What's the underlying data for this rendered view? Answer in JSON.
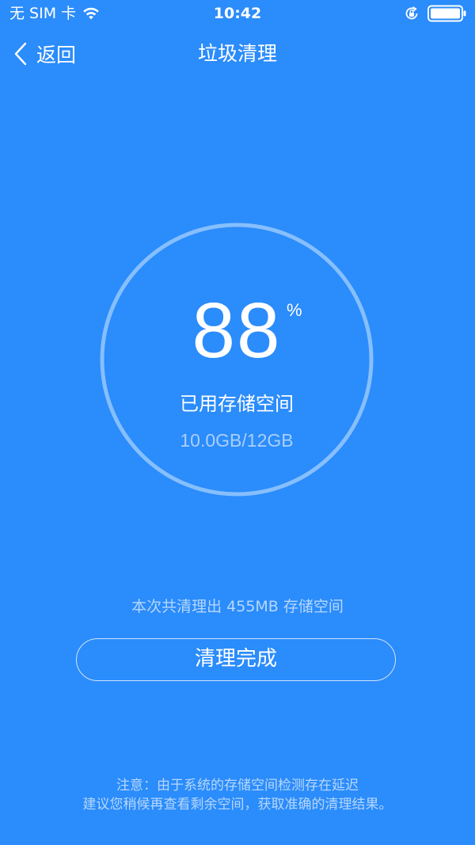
{
  "status_bar": {
    "carrier": "无 SIM 卡",
    "time": "10:42",
    "icons": [
      "wifi-icon",
      "rotation-lock-icon",
      "battery-icon"
    ]
  },
  "nav": {
    "back_label": "返回",
    "title": "垃圾清理",
    "back_icon": "chevron-left-icon"
  },
  "storage": {
    "percent": "88",
    "percent_sign": "%",
    "label": "已用存储空间",
    "amount": "10.0GB/12GB",
    "used_fraction": 0.88
  },
  "summary": {
    "text": "本次共清理出 455MB 存储空间"
  },
  "done_button": {
    "label": "清理完成"
  },
  "notice": {
    "line1": "注意：由于系统的存储空间检测存在延迟",
    "line2": "建议您稍候再查看剩余空间，获取准确的清理结果。"
  },
  "colors": {
    "background": "#2b8cfb",
    "ring": "#86bffd",
    "secondary_text": "#b6d7fd"
  }
}
